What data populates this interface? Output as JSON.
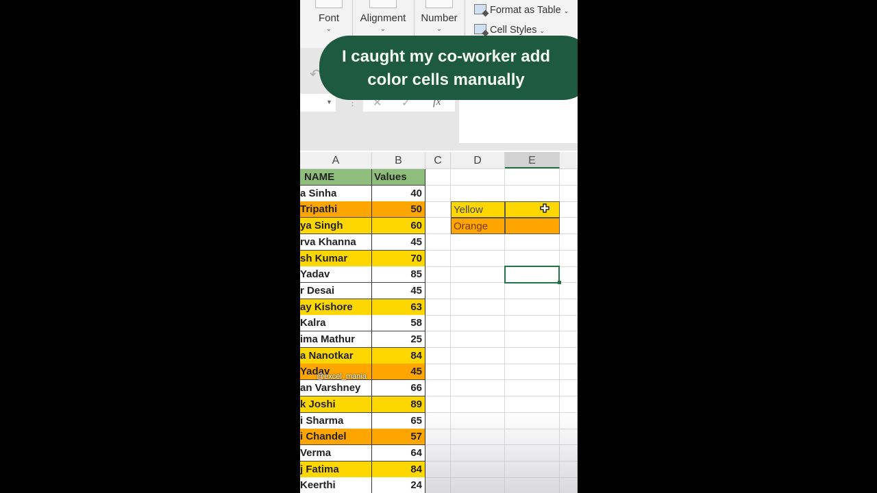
{
  "ribbon": {
    "groups": [
      {
        "label": "Font"
      },
      {
        "label": "Alignment"
      },
      {
        "label": "Number"
      }
    ],
    "styles": {
      "format_as_table": "Format as Table",
      "cell_styles": "Cell Styles"
    }
  },
  "formula_bar": {
    "cancel_icon": "✕",
    "enter_icon": "✓",
    "fx_label": "fx",
    "value": ""
  },
  "caption": {
    "line1": "I caught my co-worker add",
    "line2": "color cells manually"
  },
  "columns": [
    "A",
    "B",
    "C",
    "D",
    "E"
  ],
  "table": {
    "headers": {
      "name": "NAME",
      "values": "Values"
    },
    "rows": [
      {
        "name": "a Sinha",
        "value": "40",
        "fill": "white"
      },
      {
        "name": "Tripathi",
        "value": "50",
        "fill": "orange"
      },
      {
        "name": "ya Singh",
        "value": "60",
        "fill": "yellow"
      },
      {
        "name": "rva Khanna",
        "value": "45",
        "fill": "white"
      },
      {
        "name": "sh Kumar",
        "value": "70",
        "fill": "yellow"
      },
      {
        "name": " Yadav",
        "value": "85",
        "fill": "white"
      },
      {
        "name": "r Desai",
        "value": "45",
        "fill": "white"
      },
      {
        "name": "ay Kishore",
        "value": "63",
        "fill": "yellow"
      },
      {
        "name": "Kalra",
        "value": "58",
        "fill": "white"
      },
      {
        "name": "ima Mathur",
        "value": "25",
        "fill": "white"
      },
      {
        "name": "a Nanotkar",
        "value": "84",
        "fill": "yellow"
      },
      {
        "name": " Yadav",
        "value": "45",
        "fill": "orange"
      },
      {
        "name": "an Varshney",
        "value": "66",
        "fill": "white"
      },
      {
        "name": "k Joshi",
        "value": "89",
        "fill": "yellow"
      },
      {
        "name": "i Sharma",
        "value": "65",
        "fill": "white"
      },
      {
        "name": "i Chandel",
        "value": "57",
        "fill": "orange"
      },
      {
        "name": " Verma",
        "value": "64",
        "fill": "white"
      },
      {
        "name": "j Fatima",
        "value": "84",
        "fill": "yellow"
      },
      {
        "name": "Keerthi",
        "value": "24",
        "fill": "white"
      }
    ]
  },
  "legend": {
    "yellow_label": "Yellow",
    "yellow_value": "",
    "orange_label": "Orange",
    "orange_value": ""
  },
  "colors": {
    "header_green": "#8fbd7b",
    "yellow": "#ffd700",
    "orange": "#ffa500",
    "caption_bg": "#1e5a3f",
    "excel_green": "#217346"
  },
  "watermark": "@excel_mania"
}
